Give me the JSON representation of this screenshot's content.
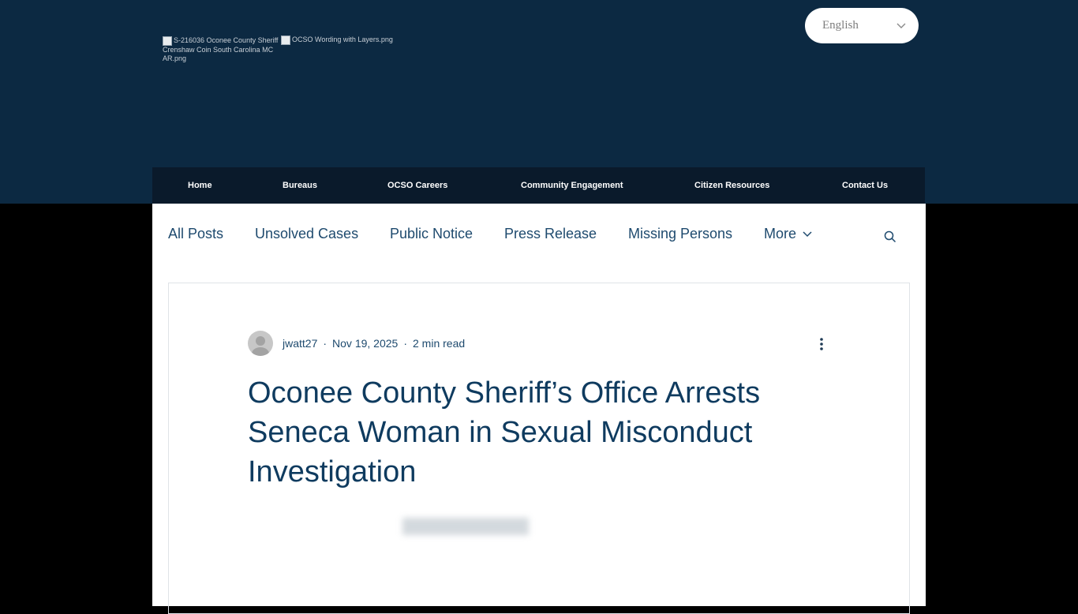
{
  "header": {
    "logo_coin_alt": "S-216036 Oconee County Sheriff Crenshaw Coin South Carolina MC AR.png",
    "logo_wording_alt": "OCSO Wording with Layers.png",
    "language": "English"
  },
  "nav": {
    "items": [
      "Home",
      "Bureaus",
      "OCSO Careers",
      "Community Engagement",
      "Citizen Resources",
      "Contact Us"
    ]
  },
  "blog": {
    "categories": [
      "All Posts",
      "Unsolved Cases",
      "Public Notice",
      "Press Release",
      "Missing Persons"
    ],
    "more_label": "More"
  },
  "post": {
    "author": "jwatt27",
    "date": "Nov 19, 2025",
    "read_time": "2 min read",
    "title": "Oconee County Sheriff’s Office Arrests Seneca Woman in Sexual Misconduct Investigation"
  },
  "colors": {
    "header_bg": "#0c2942",
    "nav_bg": "#0a1a2b",
    "link_blue": "#1e4a6e",
    "title_blue": "#0f3b5f"
  }
}
